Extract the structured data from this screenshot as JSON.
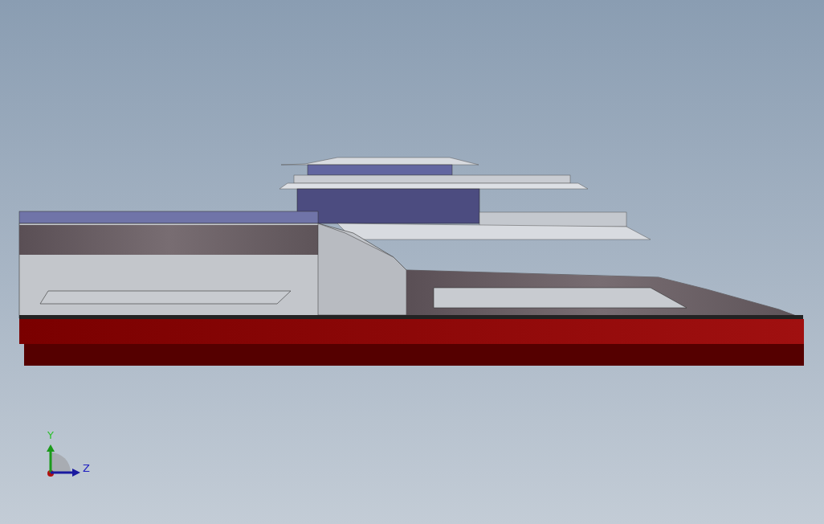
{
  "viewport": {
    "triad": [
      {
        "kind": "y",
        "label": "Y"
      },
      {
        "kind": "z",
        "label": "Z"
      }
    ]
  }
}
